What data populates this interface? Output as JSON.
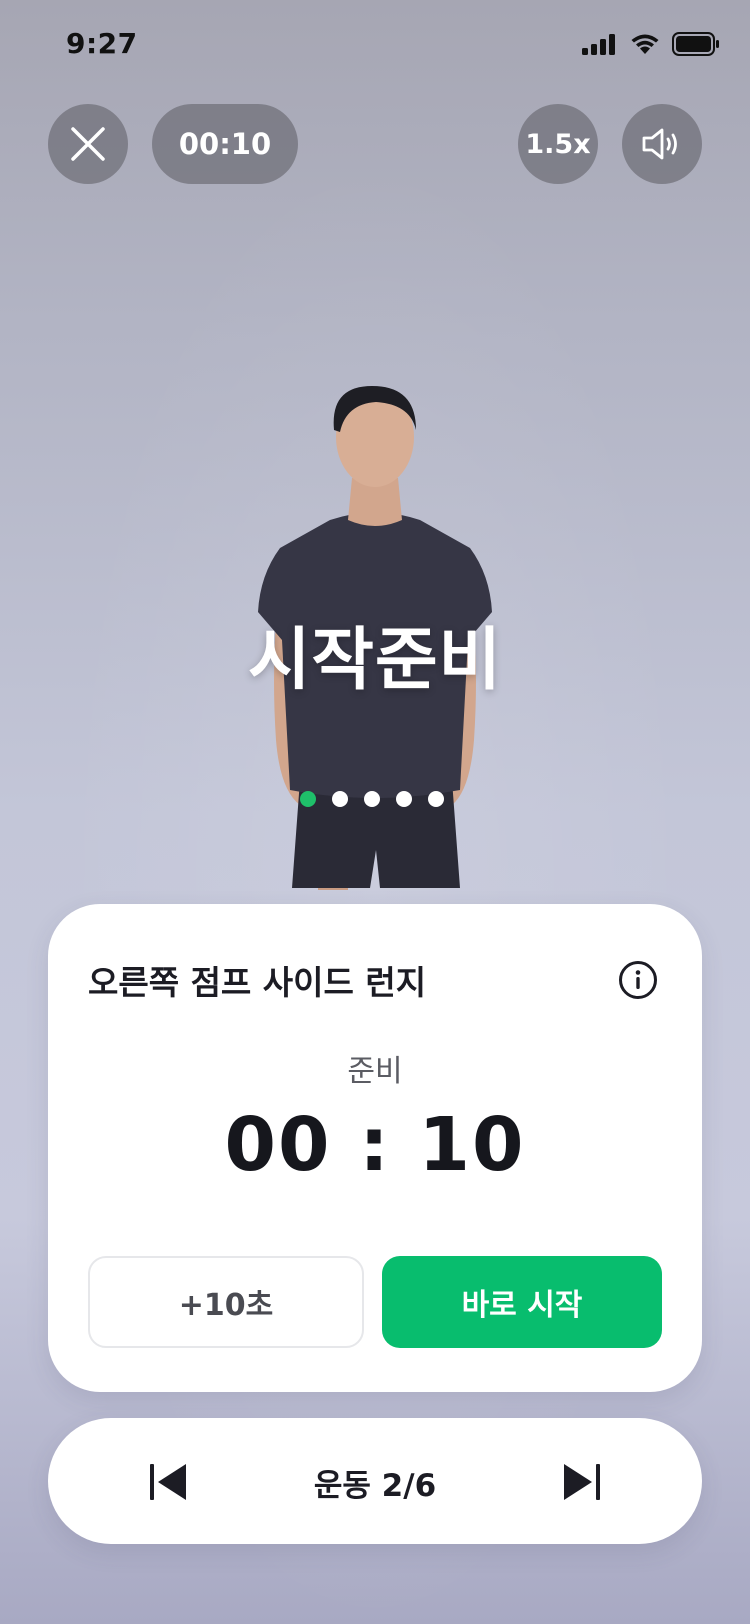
{
  "status_bar": {
    "time": "9:27"
  },
  "top_controls": {
    "elapsed": "00:10",
    "speed": "1.5x"
  },
  "video": {
    "overlay_text": "시작준비",
    "step_count": 5,
    "active_step": 1
  },
  "card": {
    "exercise_name": "오른쪽 점프 사이드 런지",
    "phase_label": "준비",
    "countdown": "00 : 10",
    "add_time_label": "+10초",
    "start_now_label": "바로 시작"
  },
  "bottom_nav": {
    "progress_label": "운동 2/6"
  },
  "colors": {
    "accent": "#08bd6e",
    "active_dot": "#1fbf6a"
  },
  "icons": {
    "close": "close-icon",
    "sound": "speaker-icon",
    "info": "info-icon",
    "prev": "skip-previous-icon",
    "next": "skip-next-icon"
  }
}
